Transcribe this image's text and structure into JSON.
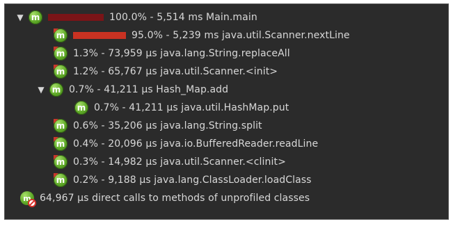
{
  "tree": {
    "rows": [
      {
        "level": 0,
        "toggle": "▼",
        "icon": "m",
        "bar": "dark",
        "text": "100.0% - 5,514 ms Main.main"
      },
      {
        "level": 1,
        "toggle": "",
        "icon": "m",
        "bar": "red",
        "text": "95.0% - 5,239 ms java.util.Scanner.nextLine"
      },
      {
        "level": 1,
        "toggle": "",
        "icon": "m",
        "bar": "",
        "text": "1.3% - 73,959 μs java.lang.String.replaceAll"
      },
      {
        "level": 1,
        "toggle": "",
        "icon": "m",
        "bar": "",
        "text": "1.2% - 65,767 μs java.util.Scanner.<init>"
      },
      {
        "level": 1,
        "toggle": "▼",
        "icon": "m",
        "bar": "",
        "text": "0.7% - 41,211 μs Hash_Map.add"
      },
      {
        "level": 2,
        "toggle": "",
        "icon": "m",
        "bar": "",
        "text": "0.7% - 41,211 μs java.util.HashMap.put"
      },
      {
        "level": 1,
        "toggle": "",
        "icon": "m",
        "bar": "",
        "text": "0.6% - 35,206 μs java.lang.String.split"
      },
      {
        "level": 1,
        "toggle": "",
        "icon": "m",
        "bar": "",
        "text": "0.4% - 20,096 μs java.io.BufferedReader.readLine"
      },
      {
        "level": 1,
        "toggle": "",
        "icon": "m",
        "bar": "",
        "text": "0.3% - 14,982 μs java.util.Scanner.<clinit>"
      },
      {
        "level": 1,
        "toggle": "",
        "icon": "m",
        "bar": "",
        "text": "0.2% - 9,188 μs java.lang.ClassLoader.loadClass"
      },
      {
        "level": 1,
        "toggle": "",
        "icon": "direct",
        "bar": "",
        "text": "64,967 μs direct calls to methods of unprofiled classes"
      }
    ]
  },
  "colors": {
    "background": "#2b2b2b",
    "text": "#d8d8d8",
    "bar_dark": "#7a1417",
    "bar_red": "#c83222",
    "icon_green": "#5fa928"
  },
  "icons": {
    "method": "method-m-icon",
    "direct": "unprofiled-direct-calls-icon",
    "expand": "expand-arrow-icon"
  }
}
